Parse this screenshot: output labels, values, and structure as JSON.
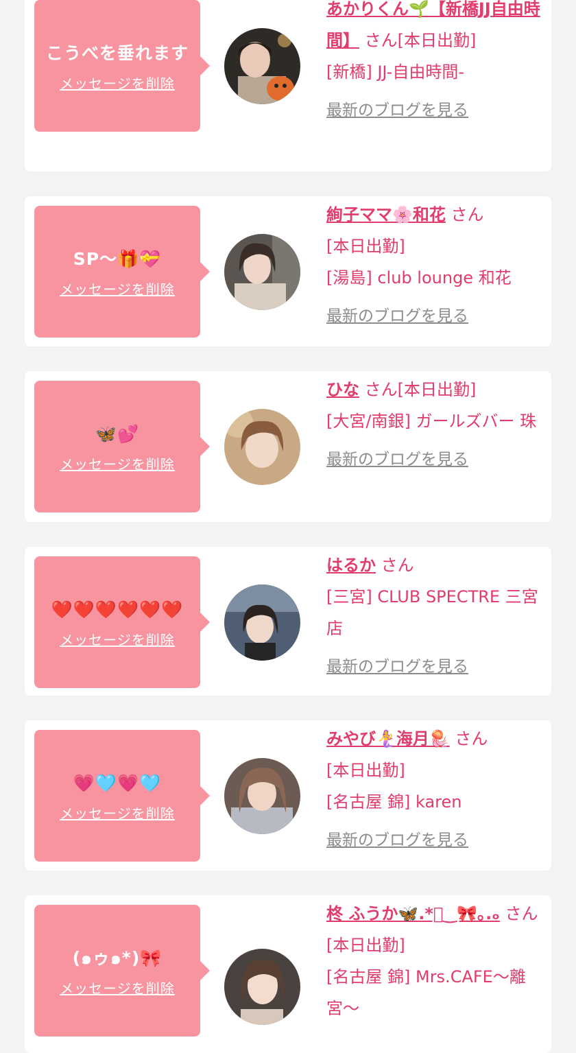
{
  "cards": [
    {
      "message": "こうべを垂れます",
      "delete_label": "メッセージを削除",
      "name": "あかりくん🌱【新橋JJ自由時間】",
      "suffix": " さん",
      "status": "[本日出勤]",
      "shop": "[新橋] JJ-自由時間-",
      "blog_label": "最新のブログを見る"
    },
    {
      "message": "SP〜🎁💝",
      "delete_label": "メッセージを削除",
      "name": "絢子ママ🌸和花",
      "suffix": " さん",
      "status": "[本日出勤]",
      "shop": "[湯島] club lounge 和花",
      "blog_label": "最新のブログを見る"
    },
    {
      "message": "🦋💕",
      "delete_label": "メッセージを削除",
      "name": "ひな",
      "suffix": " さん",
      "status": "[本日出勤]",
      "shop": "[大宮/南銀] ガールズバー 珠",
      "blog_label": "最新のブログを見る"
    },
    {
      "message": "❤️❤️❤️❤️❤️❤️",
      "delete_label": "メッセージを削除",
      "name": "はるか",
      "suffix": " さん",
      "status": "",
      "shop": "[三宮] CLUB SPECTRE 三宮店",
      "blog_label": "最新のブログを見る"
    },
    {
      "message": "💗🩵💗🩵",
      "delete_label": "メッセージを削除",
      "name": "みやび🧜‍♀️海月🪼",
      "suffix": " さん",
      "status": "[本日出勤]",
      "shop": "[名古屋 錦] karen",
      "blog_label": "最新のブログを見る"
    },
    {
      "message": "(๑ゥ๑*)🎀",
      "delete_label": "メッセージを削除",
      "name": "柊 ふうか🦋.*ﾟ‿🎀｡.ₒ",
      "suffix": " さん",
      "status": "[本日出勤]",
      "shop": "[名古屋 錦] Mrs.CAFE〜離宮〜",
      "blog_label": ""
    }
  ],
  "colors": {
    "bubble": "#f8949f",
    "accent_text": "#e13c6b",
    "link_grey": "#8c8c8c",
    "page_bg": "#f3f3f3"
  }
}
